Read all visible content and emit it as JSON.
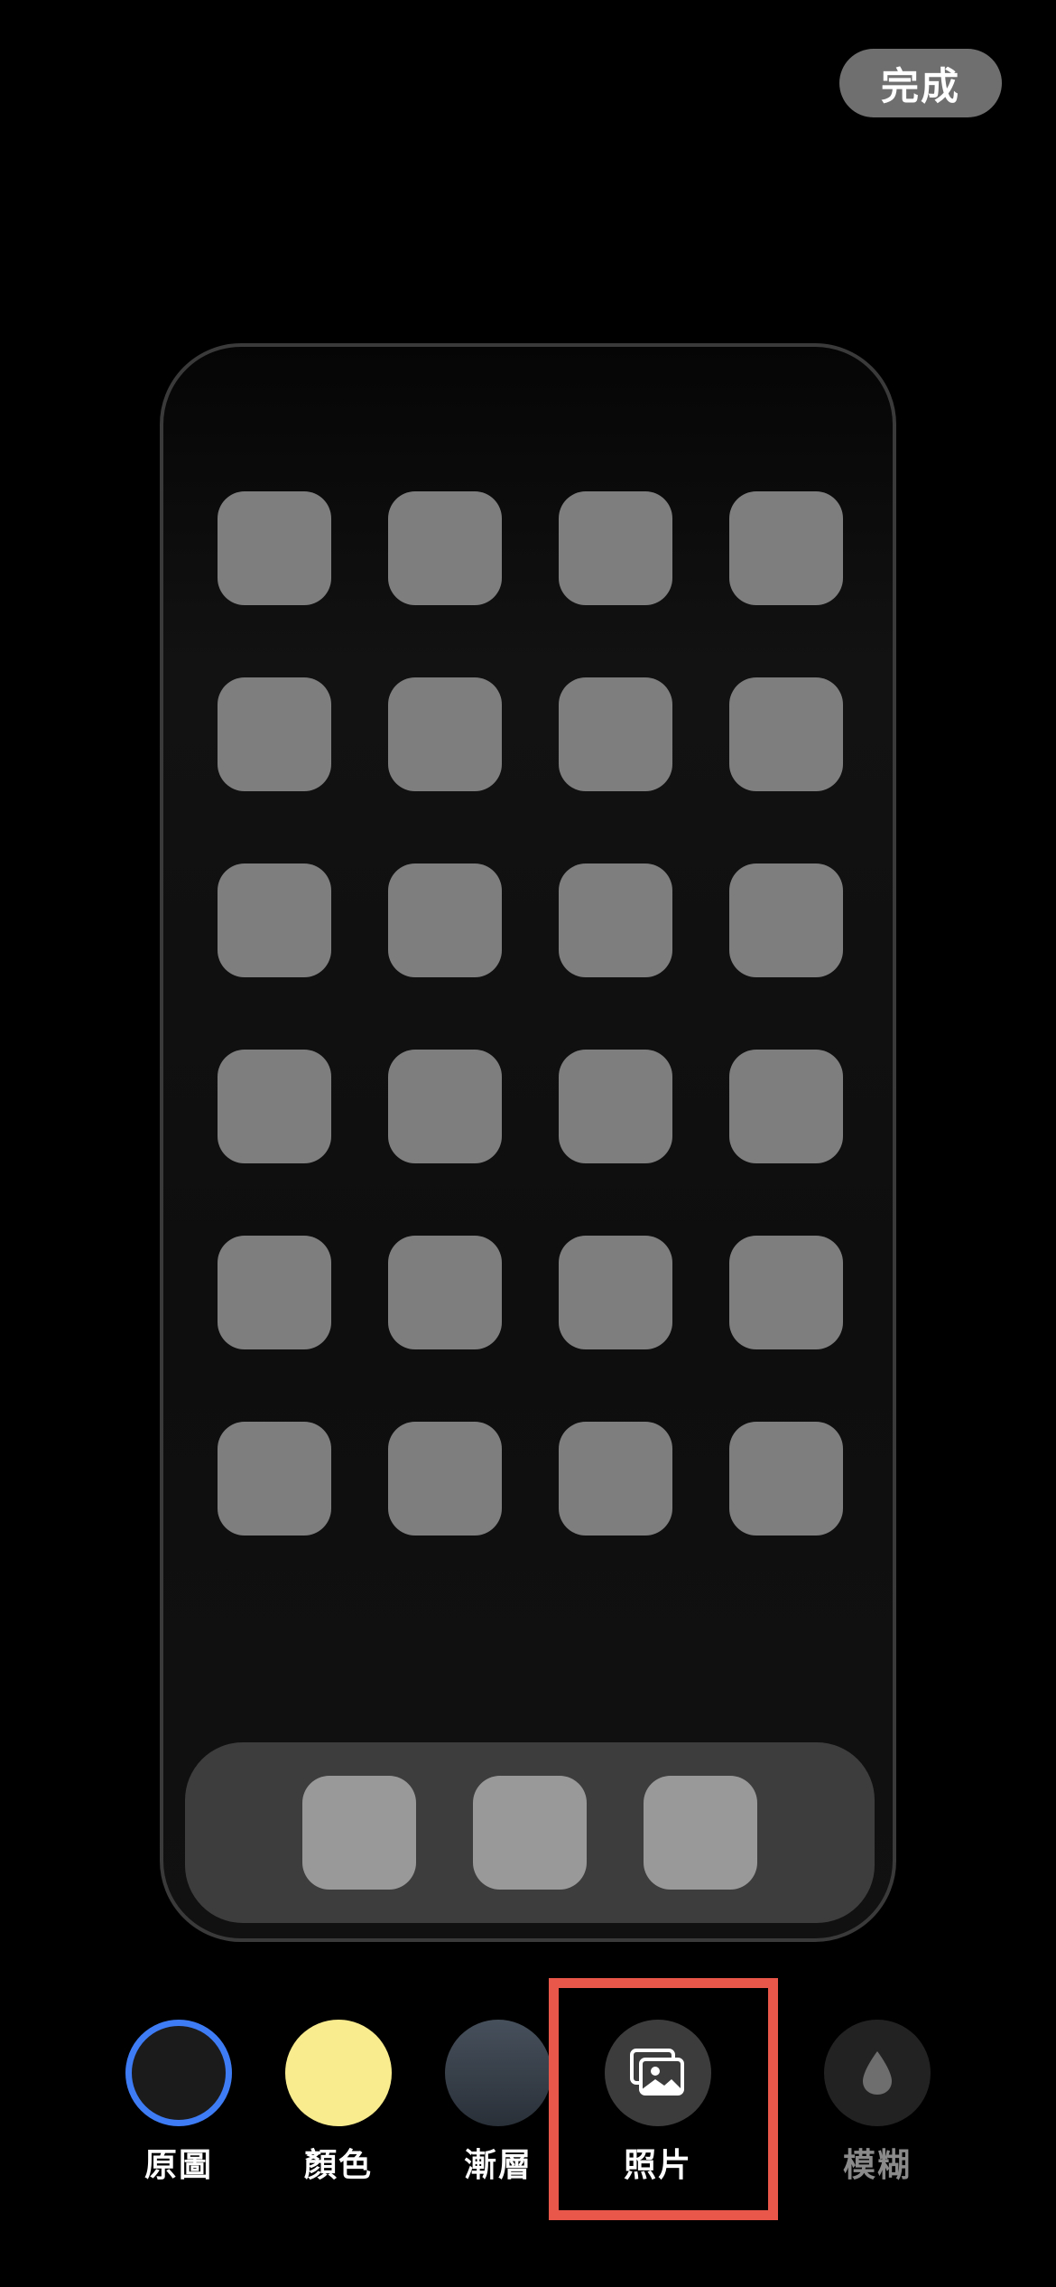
{
  "header": {
    "done_label": "完成"
  },
  "preview": {
    "app_rows": 6,
    "app_cols": 4,
    "dock_count": 3
  },
  "options": {
    "original_label": "原圖",
    "color_label": "顏色",
    "gradient_label": "漸層",
    "photos_label": "照片",
    "blur_label": "模糊"
  },
  "colors": {
    "selected_ring": "#3e7cf5",
    "color_swatch": "#f9ec8e",
    "highlight": "#e8574a"
  }
}
